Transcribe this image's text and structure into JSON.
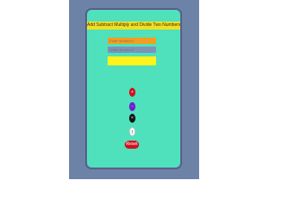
{
  "app": {
    "title": "Add Subtract Multiply and Divide Two Numbers"
  },
  "inputs": {
    "first_placeholder": "Enter Number1",
    "second_placeholder": "Enter Number2"
  },
  "result": {
    "value": ""
  },
  "buttons": {
    "add": "+",
    "subtract": "-",
    "multiply": "×",
    "divide": "/",
    "reset": "Reset"
  },
  "colors": {
    "page_background": "#6d82a7",
    "panel": "#4fe1bb",
    "title_bar": "#f3df1f",
    "input1": "#f59e1e",
    "input2": "#7f92b8",
    "result": "#fff31a",
    "add": "#d20f1f",
    "subtract": "#6f1fd0",
    "multiply": "#111111",
    "divide": "#ffffff",
    "reset": "#d20f1f"
  }
}
